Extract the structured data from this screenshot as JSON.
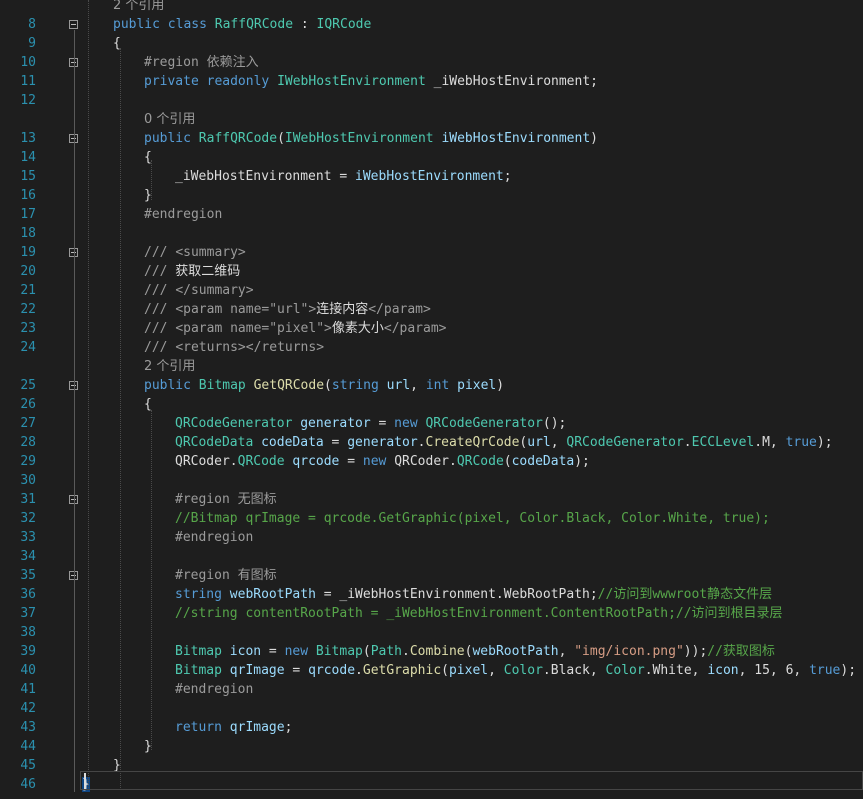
{
  "editor": {
    "lines": [
      {
        "n": "",
        "meta": true,
        "fold": false,
        "html": "2 个引用",
        "text": "2 个引用",
        "indent": 0
      },
      {
        "n": "8",
        "fold": true,
        "text": "public class RaffQRCode : IQRCode",
        "indent": 0
      },
      {
        "n": "9",
        "text": "{",
        "indent": 0
      },
      {
        "n": "10",
        "fold": true,
        "text": "#region 依赖注入",
        "indent": 1
      },
      {
        "n": "11",
        "text": "private readonly IWebHostEnvironment _iWebHostEnvironment;",
        "indent": 1
      },
      {
        "n": "12",
        "text": "",
        "indent": 1
      },
      {
        "n": "",
        "meta": true,
        "text": "0 个引用",
        "indent": 1
      },
      {
        "n": "13",
        "fold": true,
        "text": "public RaffQRCode(IWebHostEnvironment iWebHostEnvironment)",
        "indent": 1
      },
      {
        "n": "14",
        "text": "{",
        "indent": 1
      },
      {
        "n": "15",
        "text": "_iWebHostEnvironment = iWebHostEnvironment;",
        "indent": 2
      },
      {
        "n": "16",
        "text": "}",
        "indent": 1
      },
      {
        "n": "17",
        "text": "#endregion",
        "indent": 1
      },
      {
        "n": "18",
        "text": "",
        "indent": 1
      },
      {
        "n": "19",
        "fold": true,
        "text": "/// <summary>",
        "indent": 1
      },
      {
        "n": "20",
        "text": "/// 获取二维码",
        "indent": 1
      },
      {
        "n": "21",
        "text": "/// </summary>",
        "indent": 1
      },
      {
        "n": "22",
        "text": "/// <param name=\"url\">连接内容</param>",
        "indent": 1
      },
      {
        "n": "23",
        "text": "/// <param name=\"pixel\">像素大小</param>",
        "indent": 1
      },
      {
        "n": "24",
        "text": "/// <returns></returns>",
        "indent": 1
      },
      {
        "n": "",
        "meta": true,
        "text": "2 个引用",
        "indent": 1
      },
      {
        "n": "25",
        "fold": true,
        "text": "public Bitmap GetQRCode(string url, int pixel)",
        "indent": 1
      },
      {
        "n": "26",
        "text": "{",
        "indent": 1
      },
      {
        "n": "27",
        "text": "QRCodeGenerator generator = new QRCodeGenerator();",
        "indent": 2
      },
      {
        "n": "28",
        "text": "QRCodeData codeData = generator.CreateQrCode(url, QRCodeGenerator.ECCLevel.M, true);",
        "indent": 2
      },
      {
        "n": "29",
        "text": "QRCoder.QRCode qrcode = new QRCoder.QRCode(codeData);",
        "indent": 2
      },
      {
        "n": "30",
        "text": "",
        "indent": 2
      },
      {
        "n": "31",
        "fold": true,
        "text": "#region 无图标",
        "indent": 2
      },
      {
        "n": "32",
        "text": "//Bitmap qrImage = qrcode.GetGraphic(pixel, Color.Black, Color.White, true);",
        "indent": 2
      },
      {
        "n": "33",
        "text": "#endregion",
        "indent": 2
      },
      {
        "n": "34",
        "text": "",
        "indent": 2
      },
      {
        "n": "35",
        "fold": true,
        "text": "#region 有图标",
        "indent": 2
      },
      {
        "n": "36",
        "text": "string webRootPath = _iWebHostEnvironment.WebRootPath;//访问到wwwroot静态文件层",
        "indent": 2
      },
      {
        "n": "37",
        "text": "//string contentRootPath = _iWebHostEnvironment.ContentRootPath;//访问到根目录层",
        "indent": 2
      },
      {
        "n": "38",
        "text": "",
        "indent": 2
      },
      {
        "n": "39",
        "text": "Bitmap icon = new Bitmap(Path.Combine(webRootPath, \"img/icon.png\"));//获取图标",
        "indent": 2
      },
      {
        "n": "40",
        "text": "Bitmap qrImage = qrcode.GetGraphic(pixel, Color.Black, Color.White, icon, 15, 6, true);",
        "indent": 2
      },
      {
        "n": "41",
        "text": "#endregion",
        "indent": 2
      },
      {
        "n": "42",
        "text": "",
        "indent": 2
      },
      {
        "n": "43",
        "text": "return qrImage;",
        "indent": 2
      },
      {
        "n": "44",
        "text": "}",
        "indent": 1
      },
      {
        "n": "45",
        "text": "}",
        "indent": 0
      },
      {
        "n": "46",
        "text": "}",
        "indent": -1
      }
    ]
  },
  "colors": {
    "background": "#1e1e1e",
    "line_number": "#2b91af",
    "keyword": "#569cd6",
    "type": "#4ec9b0",
    "method": "#dcdcaa",
    "string": "#d69d85",
    "comment": "#57a64a",
    "xml_doc": "#608b4e",
    "text": "#dcdcdc"
  }
}
